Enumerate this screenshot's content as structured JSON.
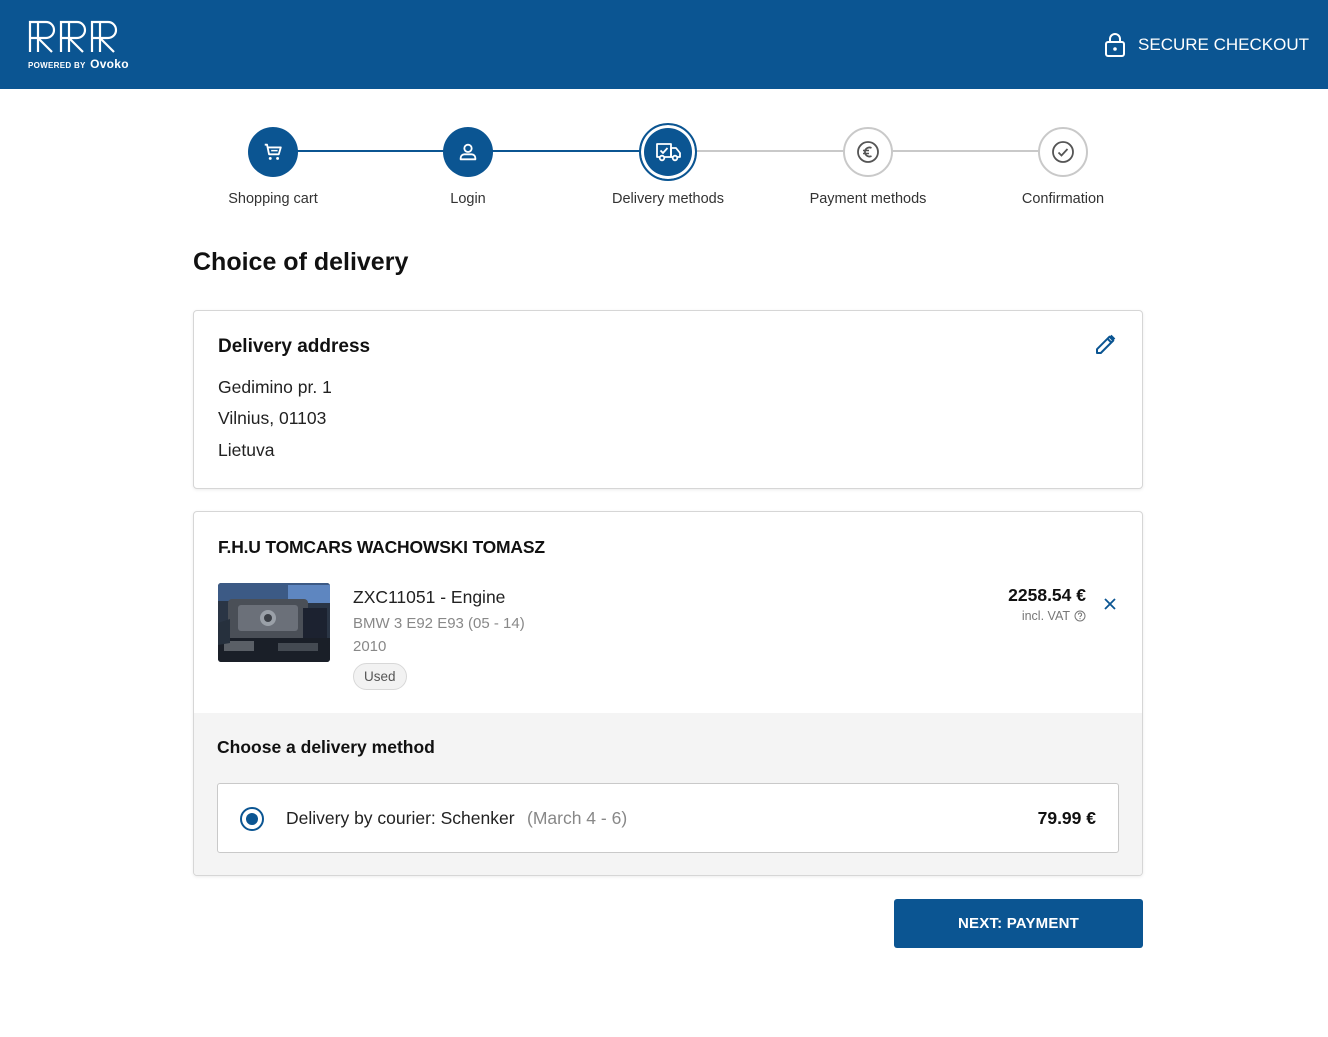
{
  "header": {
    "logo_text": "RRR",
    "powered_by": "POWERED BY",
    "powered_brand": "Ovoko",
    "secure_label": "SECURE CHECKOUT"
  },
  "stepper": {
    "steps": [
      {
        "label": "Shopping cart",
        "icon": "cart-icon",
        "state": "done"
      },
      {
        "label": "Login",
        "icon": "user-icon",
        "state": "done"
      },
      {
        "label": "Delivery methods",
        "icon": "truck-icon",
        "state": "active"
      },
      {
        "label": "Payment methods",
        "icon": "euro-icon",
        "state": "todo"
      },
      {
        "label": "Confirmation",
        "icon": "check-icon",
        "state": "todo"
      }
    ]
  },
  "page": {
    "title": "Choice of delivery"
  },
  "address": {
    "heading": "Delivery address",
    "lines": [
      "Gedimino pr. 1",
      "Vilnius, 01103",
      "Lietuva"
    ]
  },
  "seller": {
    "name": "F.H.U TOMCARS WACHOWSKI TOMASZ",
    "item": {
      "name": "ZXC11051 - Engine",
      "car": "BMW 3 E92 E93 (05 - 14)",
      "year": "2010",
      "condition": "Used",
      "price": "2258.54 €",
      "vat": "incl. VAT"
    }
  },
  "delivery": {
    "heading": "Choose a delivery method",
    "option": {
      "label": "Delivery by courier: Schenker",
      "date": "(March 4 - 6)",
      "price": "79.99 €",
      "selected": true
    }
  },
  "actions": {
    "next_label": "NEXT: PAYMENT"
  },
  "colors": {
    "brand": "#0b5592",
    "inactive_step": "#c9c9c9",
    "delivery_bg": "#f4f4f4"
  }
}
